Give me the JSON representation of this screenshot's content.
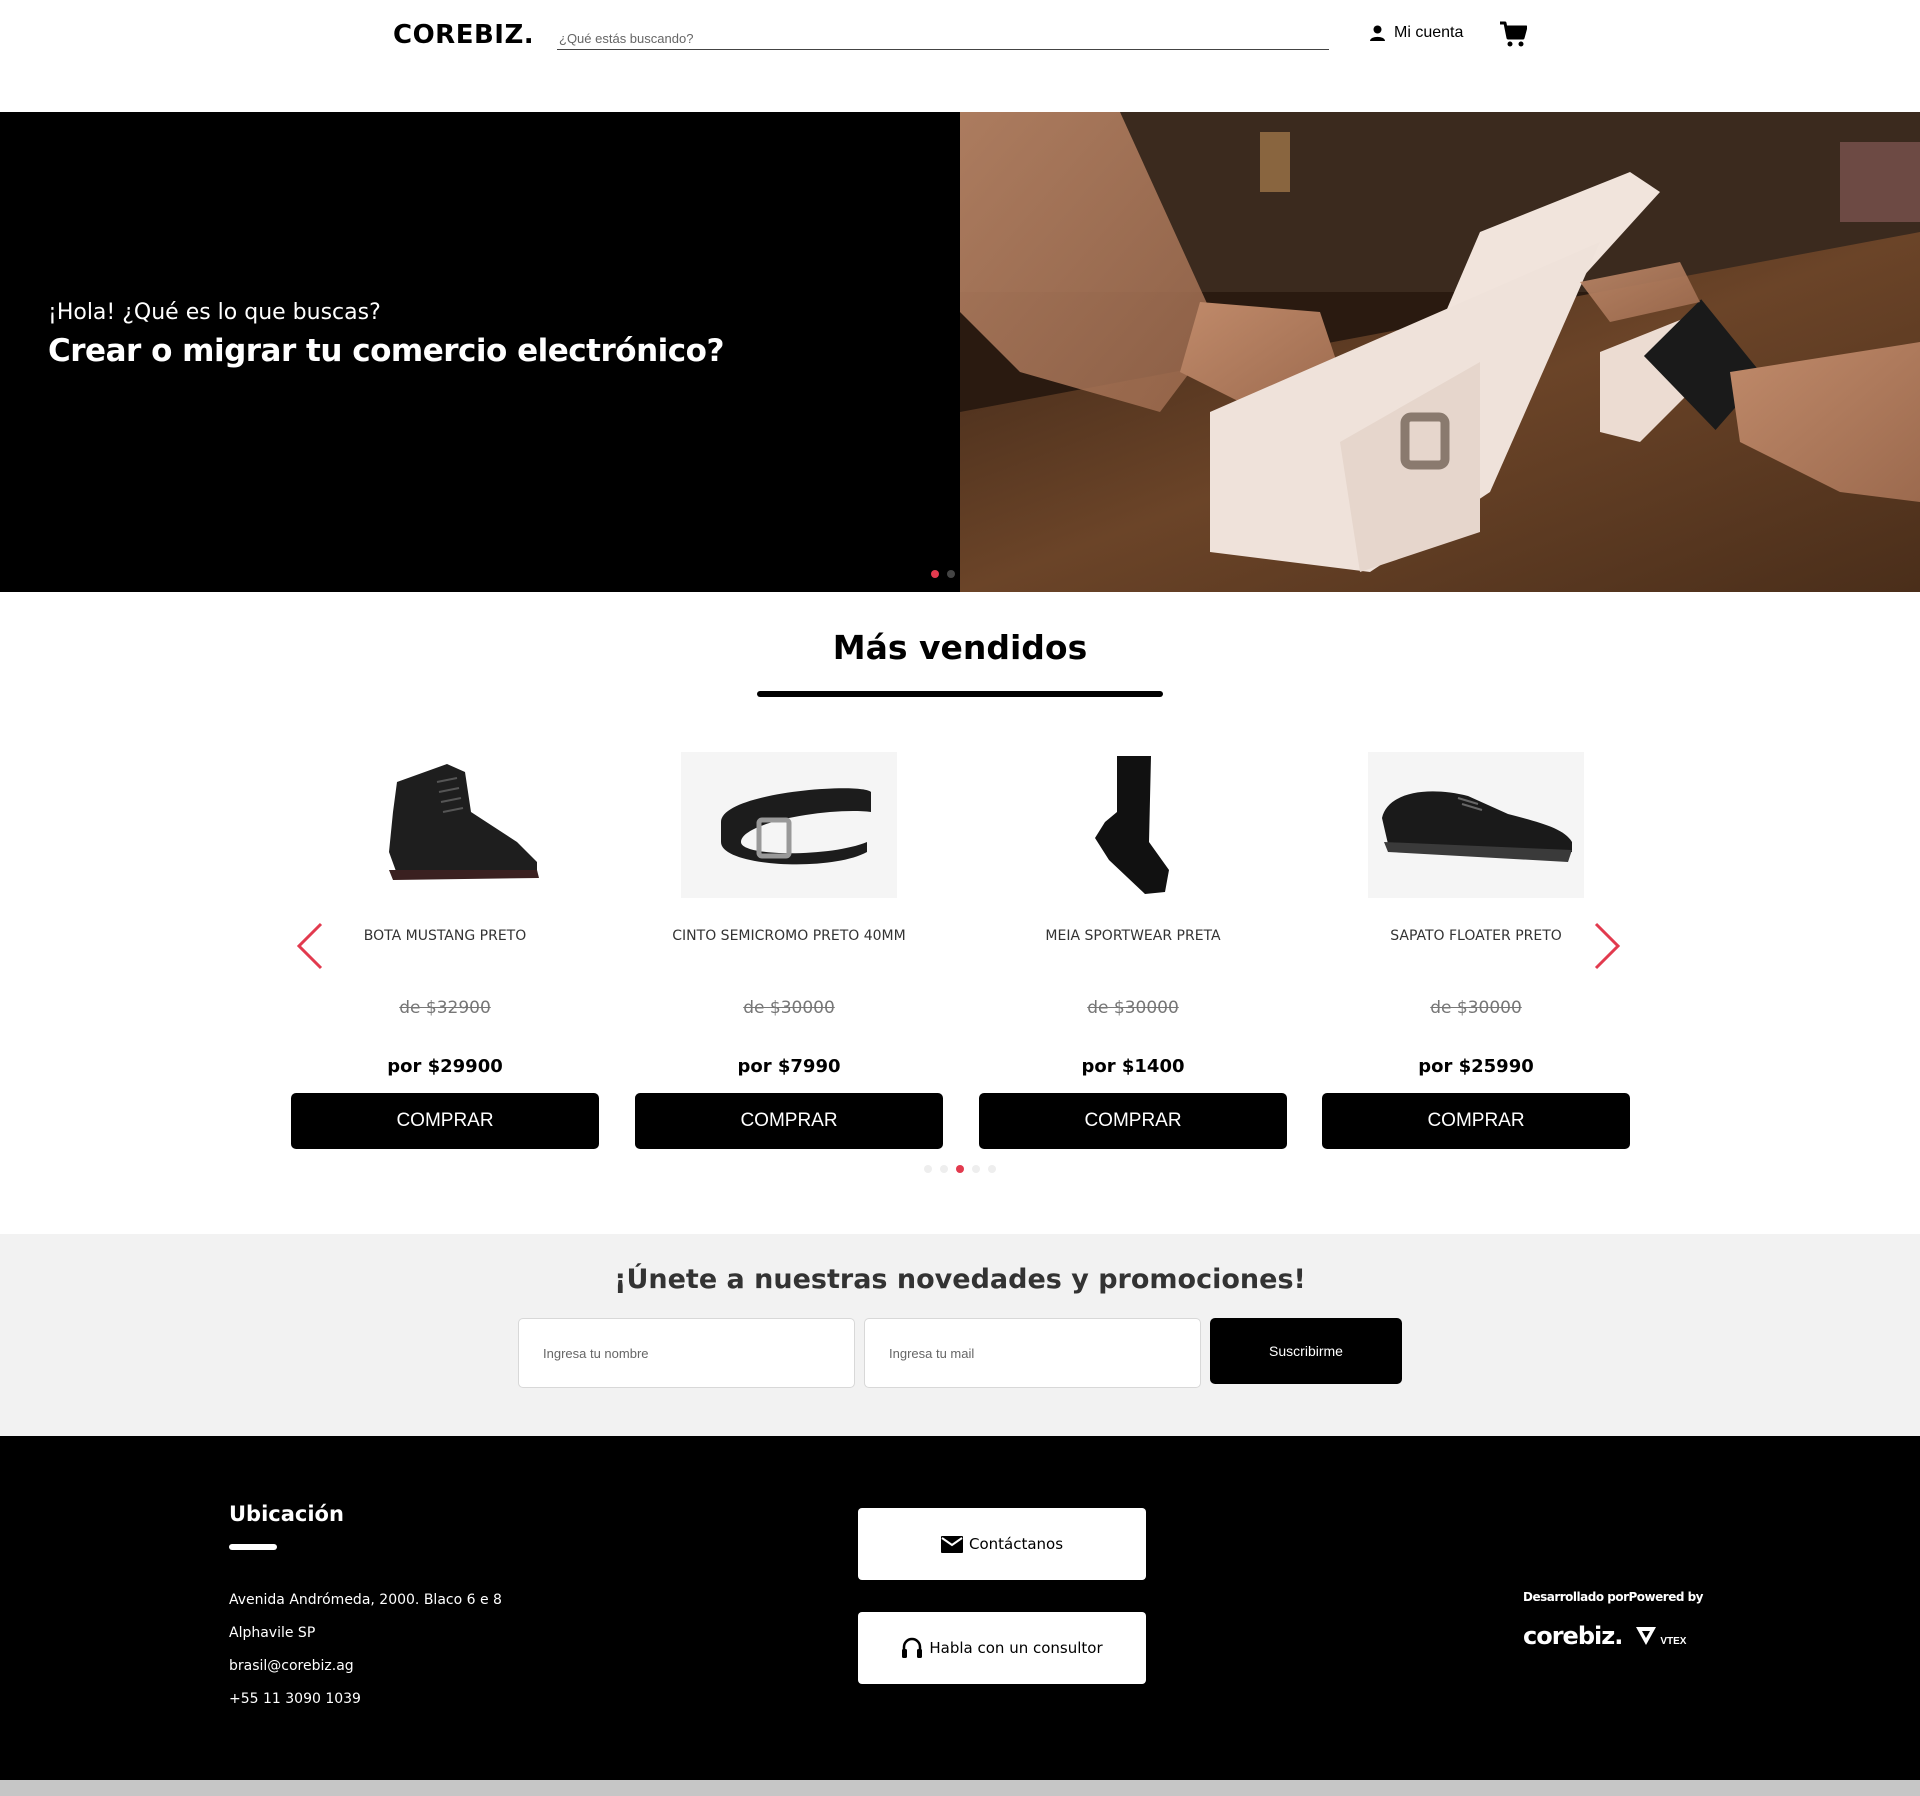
{
  "header": {
    "logo": "COREBIZ.",
    "search_placeholder": "¿Qué estás buscando?",
    "account_label": "Mi cuenta"
  },
  "hero": {
    "subtitle": "¡Hola! ¿Qué es lo que buscas?",
    "title": "Crear o migrar tu comercio electrónico?",
    "slides": 2,
    "active_slide": 1
  },
  "best_sellers": {
    "title": "Más vendidos",
    "products": [
      {
        "name": "BOTA MUSTANG PRETO",
        "old_price": "de $32900",
        "price": "por $29900",
        "button": "COMPRAR",
        "image": "boot"
      },
      {
        "name": "CINTO SEMICROMO PRETO 40MM",
        "old_price": "de $30000",
        "price": "por $7990",
        "button": "COMPRAR",
        "image": "belt"
      },
      {
        "name": "MEIA SPORTWEAR PRETA",
        "old_price": "de $30000",
        "price": "por $1400",
        "button": "COMPRAR",
        "image": "sock"
      },
      {
        "name": "SAPATO FLOATER PRETO",
        "old_price": "de $30000",
        "price": "por $25990",
        "button": "COMPRAR",
        "image": "shoe"
      }
    ],
    "pages": 5,
    "active_page": 3
  },
  "newsletter": {
    "title": "¡Únete a nuestras novedades y promociones!",
    "name_placeholder": "Ingresa tu nombre",
    "email_placeholder": "Ingresa tu mail",
    "button": "Suscribirme"
  },
  "footer": {
    "location_title": "Ubicación",
    "address_line1": "Avenida Andrómeda, 2000. Blaco 6 e 8",
    "address_line2": "Alphavile SP",
    "email": "brasil@corebiz.ag",
    "phone": "+55 11 3090 1039",
    "contact_button": "Contáctanos",
    "consultant_button": "Habla con un consultor",
    "developed_by": "Desarrollado porPowered by",
    "corebiz_logo": "corebiz.",
    "vtex_logo": "VTEX"
  },
  "colors": {
    "accent": "#e23a4e",
    "dark": "#000000",
    "newsletter_bg": "#f2f2f2"
  }
}
